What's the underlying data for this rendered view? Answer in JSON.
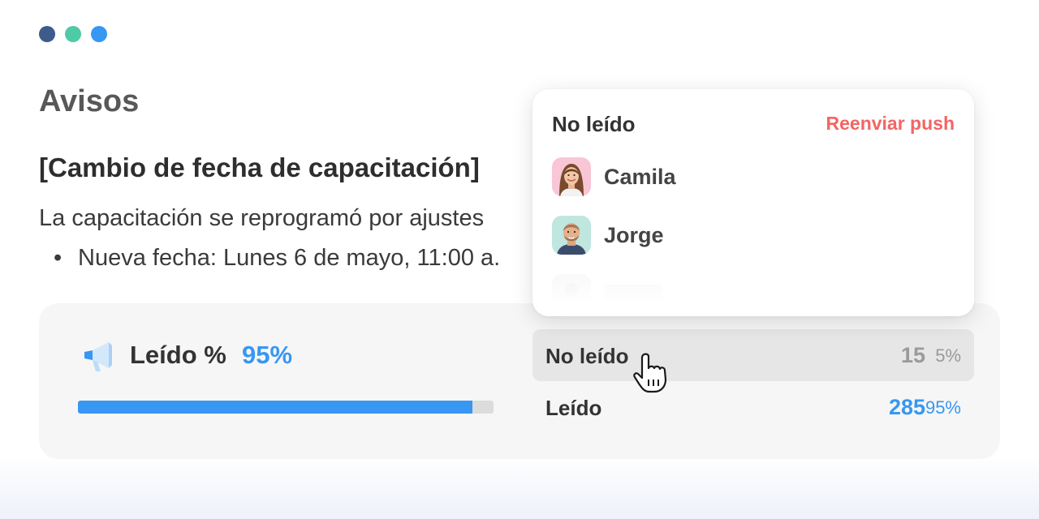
{
  "window": {
    "dots": [
      "#3d5c8a",
      "#4fcaa6",
      "#3797f2"
    ]
  },
  "page": {
    "title": "Avisos"
  },
  "notice": {
    "title": "[Cambio de fecha de capacitación]",
    "body": "La capacitación se reprogramó por ajustes",
    "bullet": "Nueva fecha: Lunes 6 de mayo, 11:00 a."
  },
  "stats": {
    "icon": "megaphone-icon",
    "read_label": "Leído %",
    "read_pct": "95%",
    "progress": 0.95,
    "rows": [
      {
        "label": "No leído",
        "count": "15",
        "pct": "5%"
      },
      {
        "label": "Leído",
        "count": "285",
        "pct": "95%"
      }
    ]
  },
  "popup": {
    "title": "No leído",
    "action": "Reenviar push",
    "users": [
      {
        "name": "Camila"
      },
      {
        "name": "Jorge"
      }
    ]
  },
  "colors": {
    "accent": "#3797f2",
    "danger": "#f26563"
  }
}
